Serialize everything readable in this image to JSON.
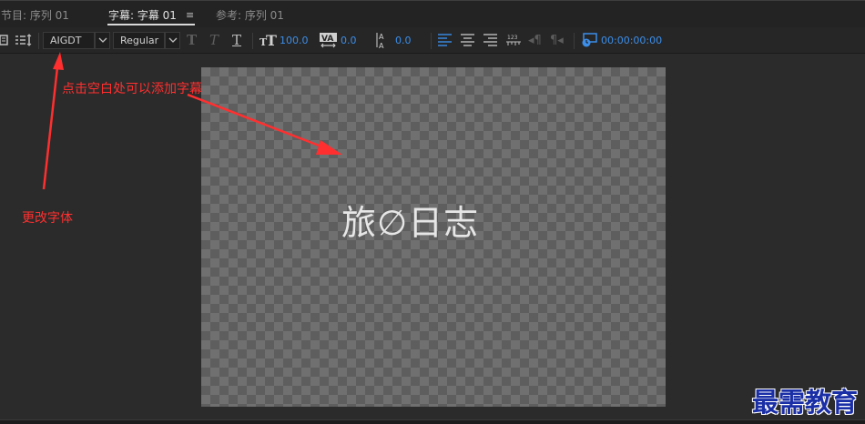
{
  "tabs": {
    "program": "节目: 序列 01",
    "titles": "字幕: 字幕 01",
    "menu_glyph": "≡",
    "reference": "参考: 序列 01"
  },
  "toolbar": {
    "font_family": "AIGDT",
    "font_style": "Regular",
    "bold_glyph": "T",
    "italic_glyph": "T",
    "underline_glyph": "T",
    "font_size": "100.0",
    "kerning": "0.0",
    "leading": "0.0",
    "timecode": "00:00:00:00"
  },
  "canvas": {
    "title_text": "旅∅日志"
  },
  "annotations": {
    "click_hint": "点击空白处可以添加字幕",
    "font_hint": "更改字体"
  },
  "watermark": "最需教育",
  "colors": {
    "accent_blue": "#3b8eea",
    "annotation_red": "#ff2f2f",
    "watermark_blue": "#1a2ea6"
  }
}
